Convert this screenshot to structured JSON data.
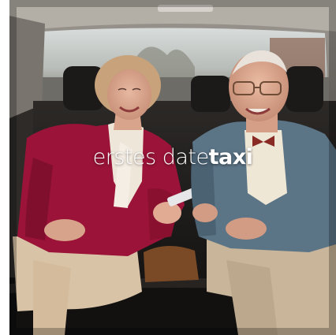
{
  "caption": {
    "light_part": "erstes date",
    "bold_part": "taxi"
  },
  "colors": {
    "cardigan_woman": "#9b1338",
    "cardigan_man": "#5b7486",
    "seat_leather": "#1d1b1a",
    "window_sky": "#c9cfcf"
  }
}
